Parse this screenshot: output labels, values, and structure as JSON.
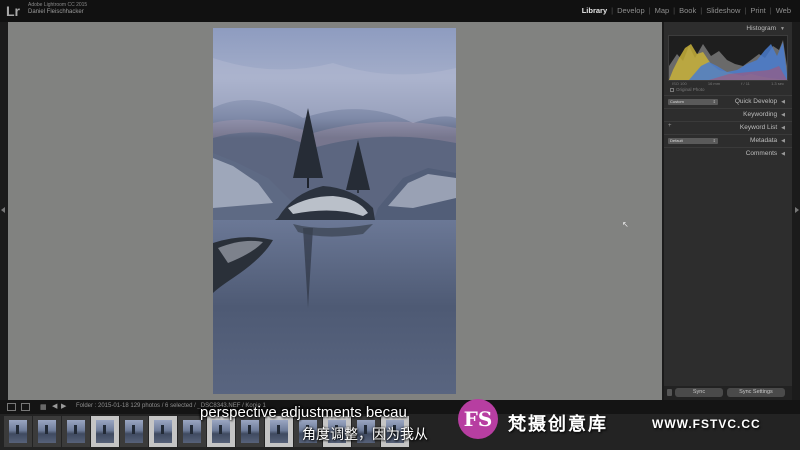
{
  "app": {
    "logo": "Lr",
    "app_name": "Adobe Lightroom CC 2015",
    "user_name": "Daniel Fleischhacker"
  },
  "modules": [
    "Library",
    "Develop",
    "Map",
    "Book",
    "Slideshow",
    "Print",
    "Web"
  ],
  "active_module": "Library",
  "right_panel": {
    "histogram": {
      "title": "Histogram",
      "info": [
        "ISO 100",
        "16 mm",
        "f / 11",
        "1.3 sec"
      ],
      "original_photo": "Original Photo"
    },
    "quick_develop": {
      "label": "Quick Develop",
      "preset": "Custom"
    },
    "keywording": {
      "label": "Keywording"
    },
    "keyword_list": {
      "label": "Keyword List"
    },
    "metadata": {
      "label": "Metadata",
      "preset": "Default"
    },
    "comments": {
      "label": "Comments"
    }
  },
  "sync": {
    "sync_label": "Sync",
    "sync_settings_label": "Sync Settings"
  },
  "filmstrip_bar": {
    "folder_text": "Folder : 2015-01-18    129 photos / 6 selected  / _DSC8343.NEF / Kopie 1"
  },
  "filmstrip": {
    "thumbnails": [
      {
        "selected": false
      },
      {
        "selected": false
      },
      {
        "selected": false
      },
      {
        "selected": true
      },
      {
        "selected": false
      },
      {
        "selected": true
      },
      {
        "selected": false
      },
      {
        "selected": true
      },
      {
        "selected": false
      },
      {
        "selected": true
      },
      {
        "selected": false
      },
      {
        "selected": true
      },
      {
        "selected": false
      },
      {
        "selected": true
      }
    ]
  },
  "overlay": {
    "subtitle_en": "perspective adjustments becau",
    "subtitle_cn": "角度调整，因为我从",
    "watermark_logo": "FS",
    "watermark_cn": "梵摄创意库",
    "watermark_url": "WWW.FSTVC.CC"
  },
  "colors": {
    "accent_watermark": "#b73ea1",
    "viewer_background": "#818280",
    "panel_background": "#2d2d2d"
  }
}
